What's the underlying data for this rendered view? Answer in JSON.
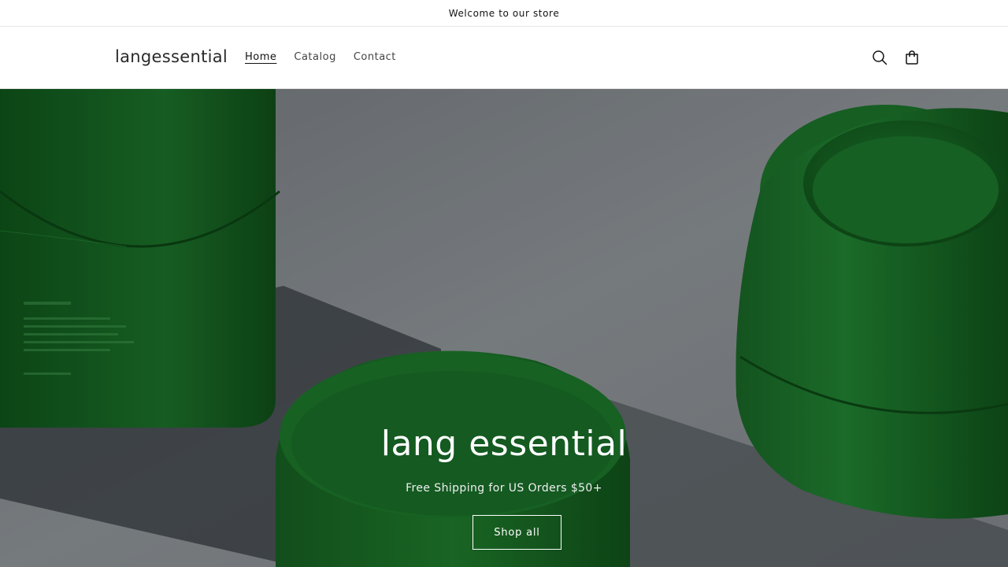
{
  "announcement": {
    "text": "Welcome to our store"
  },
  "header": {
    "logo": "langessential",
    "nav": [
      {
        "label": "Home",
        "active": true
      },
      {
        "label": "Catalog",
        "active": false
      },
      {
        "label": "Contact",
        "active": false
      }
    ],
    "icons": {
      "search": "search-icon",
      "cart": "cart-icon"
    }
  },
  "hero": {
    "title": "lang essential",
    "subtitle": "Free Shipping for US Orders $50+",
    "button_label": "Shop all",
    "colors": {
      "product_green": "#1e7a2e",
      "background": "#7c8185"
    }
  }
}
